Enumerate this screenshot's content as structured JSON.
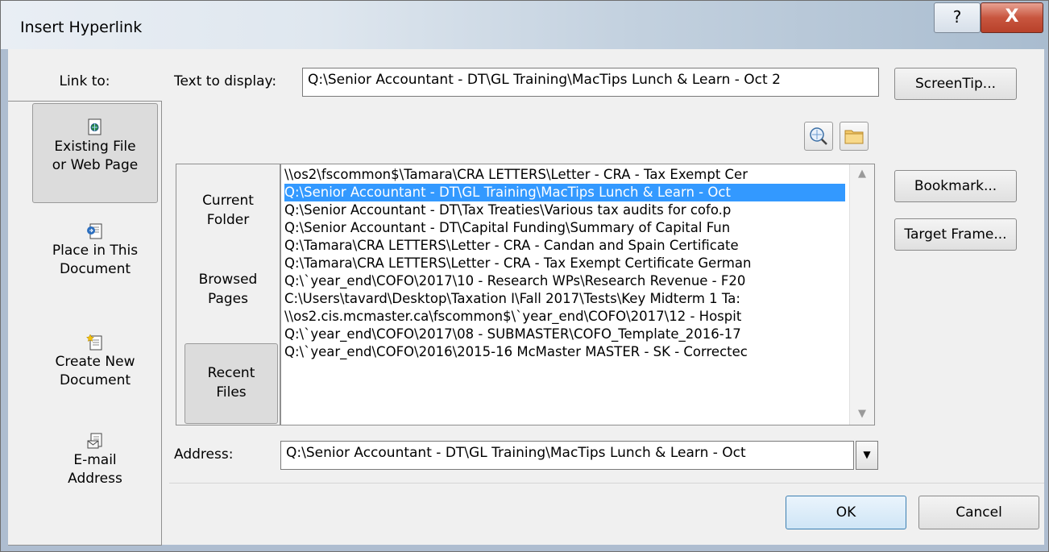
{
  "dialog": {
    "title": "Insert Hyperlink",
    "help_glyph": "?",
    "close_glyph": "X"
  },
  "link_to": {
    "label": "Link to:",
    "items": [
      {
        "line1": "Existing File",
        "line2": "or Web Page",
        "icon": "existing-file-icon"
      },
      {
        "line1": "Place in This",
        "line2": "Document",
        "icon": "place-in-document-icon"
      },
      {
        "line1": "Create New",
        "line2": "Document",
        "icon": "create-new-document-icon"
      },
      {
        "line1": "E-mail",
        "line2": "Address",
        "icon": "email-address-icon"
      }
    ]
  },
  "text_to_display": {
    "label": "Text to display:",
    "value": "Q:\\Senior Accountant - DT\\GL Training\\MacTips Lunch & Learn - Oct 2"
  },
  "buttons": {
    "screentip": "ScreenTip...",
    "bookmark": "Bookmark...",
    "target_frame": "Target Frame...",
    "ok": "OK",
    "cancel": "Cancel"
  },
  "look_in": {
    "items": [
      {
        "line1": "Current",
        "line2": "Folder"
      },
      {
        "line1": "Browsed",
        "line2": "Pages"
      },
      {
        "line1": "Recent",
        "line2": "Files"
      }
    ]
  },
  "file_list": [
    "\\\\os2\\fscommon$\\Tamara\\CRA LETTERS\\Letter - CRA - Tax Exempt Cer",
    "Q:\\Senior Accountant - DT\\GL Training\\MacTips Lunch & Learn - Oct",
    "Q:\\Senior Accountant - DT\\Tax Treaties\\Various tax audits for cofo.p",
    "Q:\\Senior Accountant - DT\\Capital Funding\\Summary of Capital Fun",
    "Q:\\Tamara\\CRA LETTERS\\Letter - CRA - Candan and Spain Certificate",
    "Q:\\Tamara\\CRA LETTERS\\Letter - CRA - Tax Exempt Certificate German",
    "Q:\\`year_end\\COFO\\2017\\10 - Research WPs\\Research Revenue - F20",
    "C:\\Users\\tavard\\Desktop\\Taxation I\\Fall 2017\\Tests\\Key Midterm 1 Ta:",
    "\\\\os2.cis.mcmaster.ca\\fscommon$\\`year_end\\COFO\\2017\\12 - Hospit",
    "Q:\\`year_end\\COFO\\2017\\08 - SUBMASTER\\COFO_Template_2016-17",
    "Q:\\`year_end\\COFO\\2016\\2015-16 McMaster MASTER - SK - Correctec"
  ],
  "selected_index": 1,
  "address": {
    "label": "Address:",
    "value": "Q:\\Senior Accountant - DT\\GL Training\\MacTips Lunch & Learn - Oct"
  }
}
